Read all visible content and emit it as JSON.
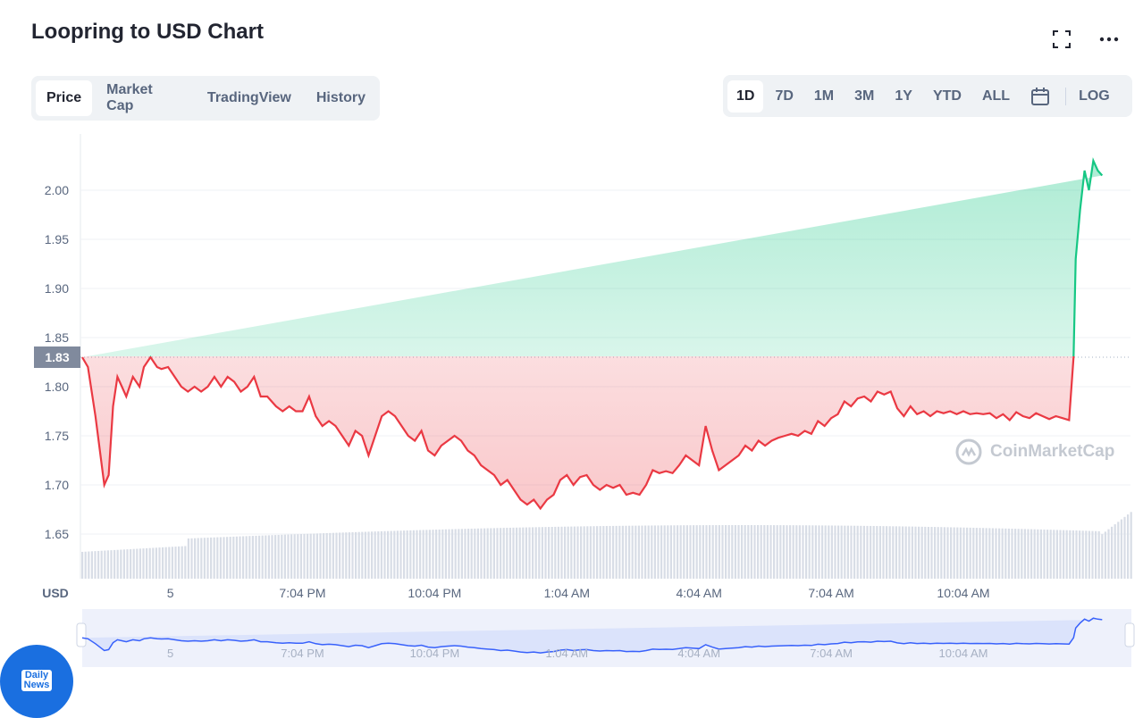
{
  "header": {
    "title": "Loopring to USD Chart",
    "fullscreen_icon": "fullscreen-icon",
    "more_icon": "more-icon"
  },
  "tabs": [
    {
      "label": "Price",
      "active": true
    },
    {
      "label": "Market Cap",
      "active": false
    },
    {
      "label": "TradingView",
      "active": false
    },
    {
      "label": "History",
      "active": false
    }
  ],
  "ranges": [
    {
      "label": "1D",
      "active": true
    },
    {
      "label": "7D",
      "active": false
    },
    {
      "label": "1M",
      "active": false
    },
    {
      "label": "3M",
      "active": false
    },
    {
      "label": "1Y",
      "active": false
    },
    {
      "label": "YTD",
      "active": false
    },
    {
      "label": "ALL",
      "active": false
    }
  ],
  "calendar_icon": "calendar-icon",
  "log_label": "LOG",
  "watermark": "CoinMarketCap",
  "badge": {
    "line1": "Daily",
    "line2": "News"
  },
  "colors": {
    "down": "#ea3943",
    "up": "#16c784",
    "volume": "#cfd6e4",
    "navigator": "#3861fb"
  },
  "chart_data": {
    "type": "line",
    "currency_label": "USD",
    "ylim": [
      1.6,
      2.05
    ],
    "yticks": [
      1.65,
      1.7,
      1.75,
      1.8,
      1.85,
      1.9,
      1.95,
      2.0
    ],
    "ytick_labels": [
      "1.65",
      "1.70",
      "1.75",
      "1.80",
      "1.85",
      "1.90",
      "1.95",
      "2.00"
    ],
    "reference_price": 1.83,
    "reference_label": "1.83",
    "xtick_labels": [
      "5",
      "7:04 PM",
      "10:04 PM",
      "1:04 AM",
      "4:04 AM",
      "7:04 AM",
      "10:04 AM"
    ],
    "xtick_hours": [
      1.0,
      4.0,
      7.0,
      10.0,
      13.0,
      16.0,
      19.0
    ],
    "xlim_hours": [
      -1.0,
      22.5
    ],
    "grid": true,
    "series": [
      {
        "x_hours": [
          -1.0,
          -0.87,
          -0.7,
          -0.5,
          -0.4,
          -0.3,
          -0.2,
          -0.1,
          0.0,
          0.15,
          0.3,
          0.4,
          0.55,
          0.7,
          0.8,
          0.95,
          1.1,
          1.25,
          1.4,
          1.55,
          1.7,
          1.85,
          2.0,
          2.15,
          2.3,
          2.45,
          2.6,
          2.75,
          2.9,
          3.05,
          3.2,
          3.4,
          3.55,
          3.7,
          3.85,
          4.0,
          4.15,
          4.3,
          4.45,
          4.6,
          4.75,
          4.9,
          5.05,
          5.2,
          5.35,
          5.5,
          5.65,
          5.8,
          5.95,
          6.1,
          6.25,
          6.4,
          6.55,
          6.7,
          6.85,
          7.0,
          7.15,
          7.3,
          7.45,
          7.6,
          7.75,
          7.9,
          8.05,
          8.2,
          8.35,
          8.5,
          8.65,
          8.8,
          8.95,
          9.1,
          9.25,
          9.4,
          9.55,
          9.7,
          9.85,
          10.0,
          10.15,
          10.3,
          10.45,
          10.6,
          10.75,
          10.9,
          11.05,
          11.2,
          11.35,
          11.5,
          11.65,
          11.8,
          11.95,
          12.1,
          12.25,
          12.4,
          12.55,
          12.7,
          12.85,
          13.0,
          13.15,
          13.3,
          13.45,
          13.6,
          13.75,
          13.9,
          14.05,
          14.2,
          14.35,
          14.5,
          14.65,
          14.8,
          14.95,
          15.1,
          15.25,
          15.4,
          15.55,
          15.7,
          15.85,
          16.0,
          16.15,
          16.3,
          16.45,
          16.6,
          16.75,
          16.9,
          17.05,
          17.2,
          17.35,
          17.5,
          17.65,
          17.8,
          17.95,
          18.1,
          18.25,
          18.4,
          18.55,
          18.7,
          18.85,
          19.0,
          19.15,
          19.3,
          19.45,
          19.6,
          19.75,
          19.9,
          20.05,
          20.2,
          20.35,
          20.5,
          20.65,
          20.8,
          20.95,
          21.1,
          21.25,
          21.4,
          21.5,
          21.55,
          21.65,
          21.75,
          21.85,
          21.95,
          22.05,
          22.15,
          22.3,
          22.45
        ],
        "values": [
          1.83,
          1.82,
          1.77,
          1.7,
          1.71,
          1.78,
          1.81,
          1.8,
          1.79,
          1.81,
          1.8,
          1.82,
          1.83,
          1.82,
          1.818,
          1.82,
          1.81,
          1.8,
          1.795,
          1.8,
          1.795,
          1.8,
          1.81,
          1.8,
          1.81,
          1.805,
          1.795,
          1.8,
          1.81,
          1.79,
          1.79,
          1.78,
          1.775,
          1.78,
          1.775,
          1.775,
          1.79,
          1.77,
          1.76,
          1.765,
          1.76,
          1.75,
          1.74,
          1.755,
          1.75,
          1.73,
          1.75,
          1.77,
          1.775,
          1.77,
          1.76,
          1.75,
          1.745,
          1.755,
          1.735,
          1.73,
          1.74,
          1.745,
          1.75,
          1.745,
          1.735,
          1.73,
          1.72,
          1.715,
          1.71,
          1.7,
          1.705,
          1.695,
          1.685,
          1.68,
          1.685,
          1.676,
          1.685,
          1.69,
          1.705,
          1.71,
          1.7,
          1.708,
          1.71,
          1.7,
          1.695,
          1.7,
          1.697,
          1.7,
          1.69,
          1.692,
          1.69,
          1.7,
          1.715,
          1.712,
          1.714,
          1.712,
          1.72,
          1.73,
          1.725,
          1.72,
          1.76,
          1.735,
          1.715,
          1.72,
          1.725,
          1.73,
          1.74,
          1.735,
          1.745,
          1.74,
          1.745,
          1.748,
          1.75,
          1.752,
          1.75,
          1.755,
          1.752,
          1.765,
          1.76,
          1.768,
          1.772,
          1.785,
          1.78,
          1.788,
          1.79,
          1.785,
          1.795,
          1.792,
          1.795,
          1.778,
          1.77,
          1.78,
          1.772,
          1.775,
          1.77,
          1.775,
          1.773,
          1.775,
          1.772,
          1.775,
          1.772,
          1.773,
          1.772,
          1.773,
          1.768,
          1.772,
          1.766,
          1.774,
          1.77,
          1.768,
          1.773,
          1.77,
          1.767,
          1.77,
          1.768,
          1.766,
          1.83,
          1.93,
          1.98,
          2.02,
          2.0,
          2.03,
          2.02,
          2.015
        ]
      }
    ]
  }
}
